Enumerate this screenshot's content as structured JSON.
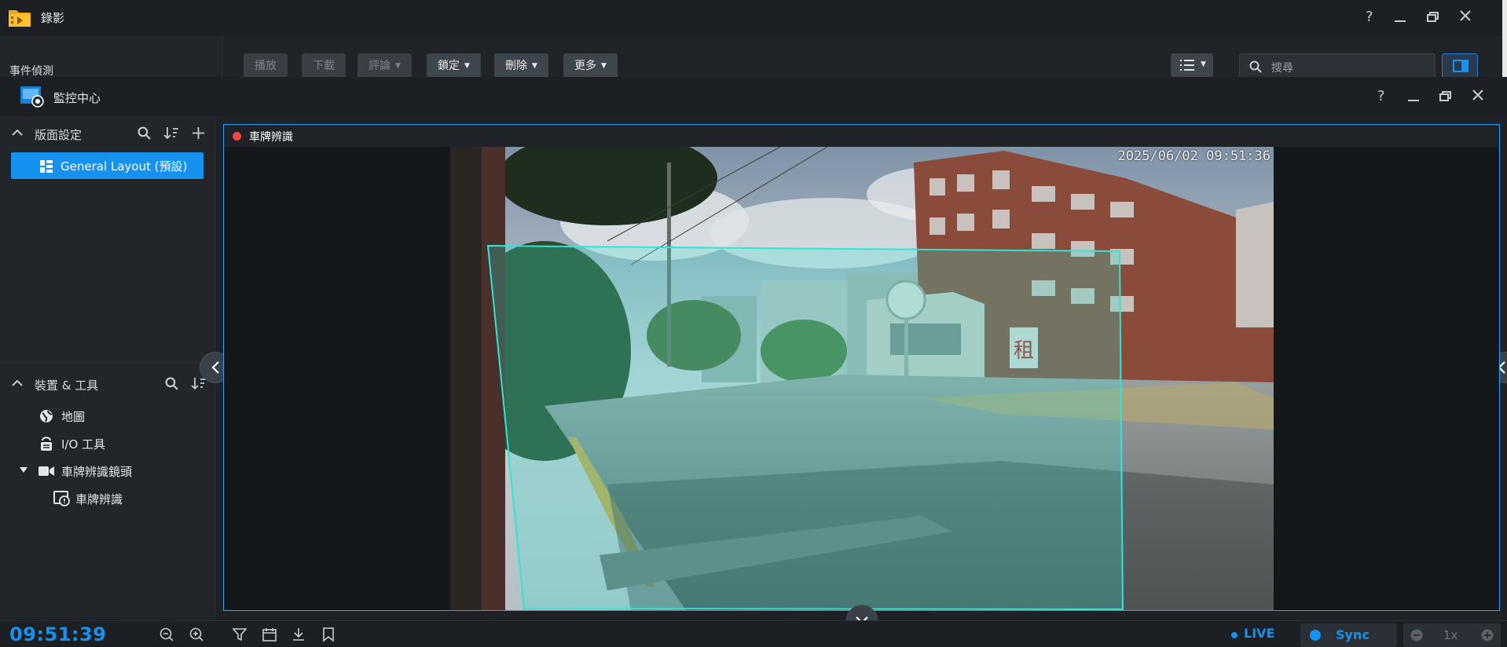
{
  "colors": {
    "accent": "#1592f0",
    "record_dot": "#ea4b45",
    "detection_zone": "#2ee6d6"
  },
  "background_window": {
    "title": "錄影",
    "app_icon": "recording-folder-icon",
    "sidebar_label": "事件偵測",
    "toolbar": [
      {
        "label": "播放",
        "enabled": false
      },
      {
        "label": "下載",
        "enabled": false
      },
      {
        "label": "評論",
        "enabled": false,
        "dropdown": true
      },
      {
        "label": "鎖定",
        "enabled": true,
        "dropdown": true
      },
      {
        "label": "刪除",
        "enabled": true,
        "dropdown": true
      },
      {
        "label": "更多",
        "enabled": true,
        "dropdown": true
      }
    ],
    "search_placeholder": "搜尋",
    "window_controls": [
      "help-icon",
      "minimize-icon",
      "restore-icon",
      "close-icon"
    ]
  },
  "window": {
    "title": "監控中心",
    "app_icon": "surveillance-center-icon",
    "controls": [
      "help-icon",
      "minimize-icon",
      "restore-icon",
      "close-icon"
    ]
  },
  "layout_section": {
    "title": "版面設定",
    "selected_layout": "General Layout (預設)"
  },
  "devices_section": {
    "title": "裝置 & 工具",
    "items": [
      {
        "label": "地圖",
        "icon": "globe-icon"
      },
      {
        "label": "I/O 工具",
        "icon": "io-module-icon"
      },
      {
        "label": "車牌辨識鏡頭",
        "icon": "camera-icon",
        "expanded": true
      },
      {
        "label": "車牌辨識",
        "icon": "lpr-camera-icon",
        "child": true
      }
    ]
  },
  "view": {
    "title": "車牌辨識",
    "timestamp": "2025/06/02 09:51:36",
    "recording": true
  },
  "bottom_bar": {
    "clock": "09:51:39",
    "live_label": "LIVE",
    "sync_label": "Sync",
    "speed": "1x"
  }
}
